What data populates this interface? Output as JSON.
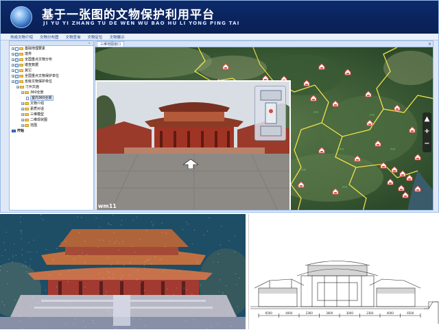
{
  "app": {
    "title": "基于一张图的文物保护利用平台",
    "subtitle": "JI YU YI ZHANG TU DE WEN WU BAO HU LI YONG PING TAI"
  },
  "menu": [
    "热成文物介绍",
    "文物分布图",
    "文物查询",
    "文物定位",
    "文物展示"
  ],
  "tree": {
    "items": [
      {
        "label": "基础地理要素",
        "depth": 0,
        "check": "off",
        "icon": "folder"
      },
      {
        "label": "境界",
        "depth": 0,
        "check": "on",
        "icon": "folder"
      },
      {
        "label": "全国重点文物分布",
        "depth": 0,
        "check": "on",
        "icon": "folder"
      },
      {
        "label": "堪查数据",
        "depth": 0,
        "check": "on",
        "icon": "folder"
      },
      {
        "label": "其它",
        "depth": 0,
        "check": "off",
        "icon": "folder"
      },
      {
        "label": "全国重点文物保护单位",
        "depth": 0,
        "check": "on",
        "icon": "folder"
      },
      {
        "label": "省级文物保护单位",
        "depth": 0,
        "check": "on",
        "icon": "folder"
      },
      {
        "label": "汀州文庙",
        "depth": 1,
        "check": "none",
        "icon": "folder"
      },
      {
        "label": "360全景",
        "depth": 2,
        "check": "none",
        "icon": "folder"
      },
      {
        "label": "室内360全景",
        "depth": 3,
        "check": "none",
        "icon": "page",
        "selected": true
      },
      {
        "label": "文物介绍",
        "depth": 2,
        "check": "none",
        "icon": "folder"
      },
      {
        "label": "素质对话",
        "depth": 2,
        "check": "none",
        "icon": "folder"
      },
      {
        "label": "三维模型",
        "depth": 2,
        "check": "none",
        "icon": "folder"
      },
      {
        "label": "二维现状图",
        "depth": 2,
        "check": "none",
        "icon": "folder"
      },
      {
        "label": "范围",
        "depth": 2,
        "check": "none",
        "icon": "folder"
      },
      {
        "label": "开始",
        "depth": 0,
        "check": "none",
        "icon": "start",
        "bold": true
      }
    ]
  },
  "map": {
    "tab_label": "三维地图窗口",
    "zoom_in": "+",
    "zoom_out": "−"
  },
  "pano": {
    "label": "wm11"
  },
  "drawing": {
    "dimensions": [
      "6500",
      "4000",
      "2360",
      "3000",
      "3000",
      "2360",
      "4000",
      "6500"
    ]
  },
  "colors": {
    "banner": "#0c2a6a",
    "frame": "#dfe8f6",
    "border_line": "#f2e14a",
    "marker": "#e0504a"
  }
}
